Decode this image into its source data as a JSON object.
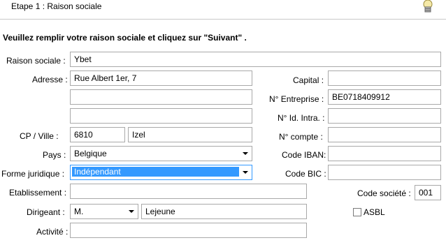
{
  "header": {
    "step_title": "Etape 1 : Raison sociale"
  },
  "instruction": "Veuillez remplir votre raison sociale et cliquez sur \"Suivant\" .",
  "form": {
    "raison_sociale": {
      "label": "Raison sociale :",
      "value": "Ybet"
    },
    "adresse": {
      "label": "Adresse :",
      "line1": "Rue Albert 1er, 7",
      "line2": "",
      "line3": ""
    },
    "cp_ville": {
      "label": "CP / Ville :",
      "cp": "6810",
      "ville": "Izel"
    },
    "pays": {
      "label": "Pays :",
      "value": "Belgique"
    },
    "forme_juridique": {
      "label": "Forme juridique :",
      "value": "Indépendant"
    },
    "etablissement": {
      "label": "Etablissement :",
      "value": ""
    },
    "dirigeant": {
      "label": "Dirigeant :",
      "civilite": "M.",
      "nom": "Lejeune"
    },
    "activite": {
      "label": "Activité :",
      "value": ""
    },
    "capital": {
      "label": "Capital :",
      "value": ""
    },
    "n_entreprise": {
      "label": "N° Entreprise :",
      "value": "BE0718409912"
    },
    "n_id_intra": {
      "label": "N° Id. Intra. :",
      "value": ""
    },
    "n_compte": {
      "label": "N° compte :",
      "value": ""
    },
    "code_iban": {
      "label": "Code IBAN:",
      "value": ""
    },
    "code_bic": {
      "label": "Code BIC :",
      "value": ""
    },
    "code_societe": {
      "label": "Code société :",
      "value": "001"
    },
    "asbl": {
      "label": "ASBL",
      "checked": false
    }
  },
  "icons": {
    "header_icon": "lightbulb-icon",
    "dropdown": "chevron-down-icon"
  }
}
